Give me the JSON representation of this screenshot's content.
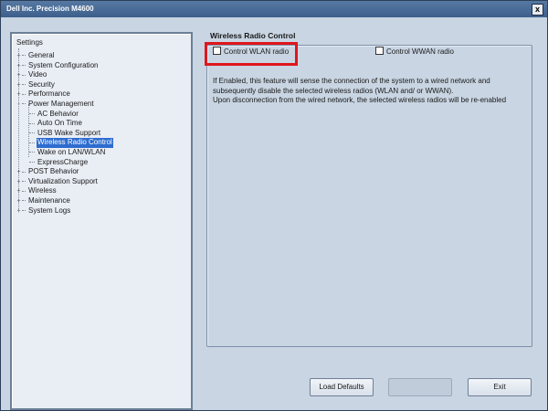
{
  "window": {
    "title": "Dell Inc. Precision M4600",
    "close_label": "x"
  },
  "tree": {
    "root_label": "Settings",
    "items": [
      {
        "label": "General",
        "expander": "+"
      },
      {
        "label": "System Configuration",
        "expander": "+"
      },
      {
        "label": "Video",
        "expander": "+"
      },
      {
        "label": "Security",
        "expander": "+"
      },
      {
        "label": "Performance",
        "expander": "+"
      },
      {
        "label": "Power Management",
        "expander": "-"
      },
      {
        "label": "AC Behavior",
        "child": true
      },
      {
        "label": "Auto On Time",
        "child": true
      },
      {
        "label": "USB Wake Support",
        "child": true
      },
      {
        "label": "Wireless Radio Control",
        "child": true,
        "selected": true
      },
      {
        "label": "Wake on LAN/WLAN",
        "child": true
      },
      {
        "label": "ExpressCharge",
        "child": true
      },
      {
        "label": "POST Behavior",
        "expander": "+"
      },
      {
        "label": "Virtualization Support",
        "expander": "+"
      },
      {
        "label": "Wireless",
        "expander": "+"
      },
      {
        "label": "Maintenance",
        "expander": "+"
      },
      {
        "label": "System Logs",
        "expander": "+"
      }
    ]
  },
  "panel": {
    "group_title": "Wireless Radio Control",
    "wlan_label": "Control WLAN radio",
    "wwan_label": "Control WWAN radio",
    "wlan_checked": false,
    "wwan_checked": false,
    "description": [
      "If Enabled, this feature will sense the connection of the system to a wired network and",
      "subsequently disable the selected wireless radios (WLAN and/ or WWAN).",
      "Upon disconnection from the wired network, the selected wireless radios will be re-enabled"
    ]
  },
  "buttons": {
    "load_defaults": "Load Defaults",
    "apply": "",
    "exit": "Exit"
  },
  "colors": {
    "highlight": "#e0161d",
    "selected": "#2d6cd0"
  }
}
